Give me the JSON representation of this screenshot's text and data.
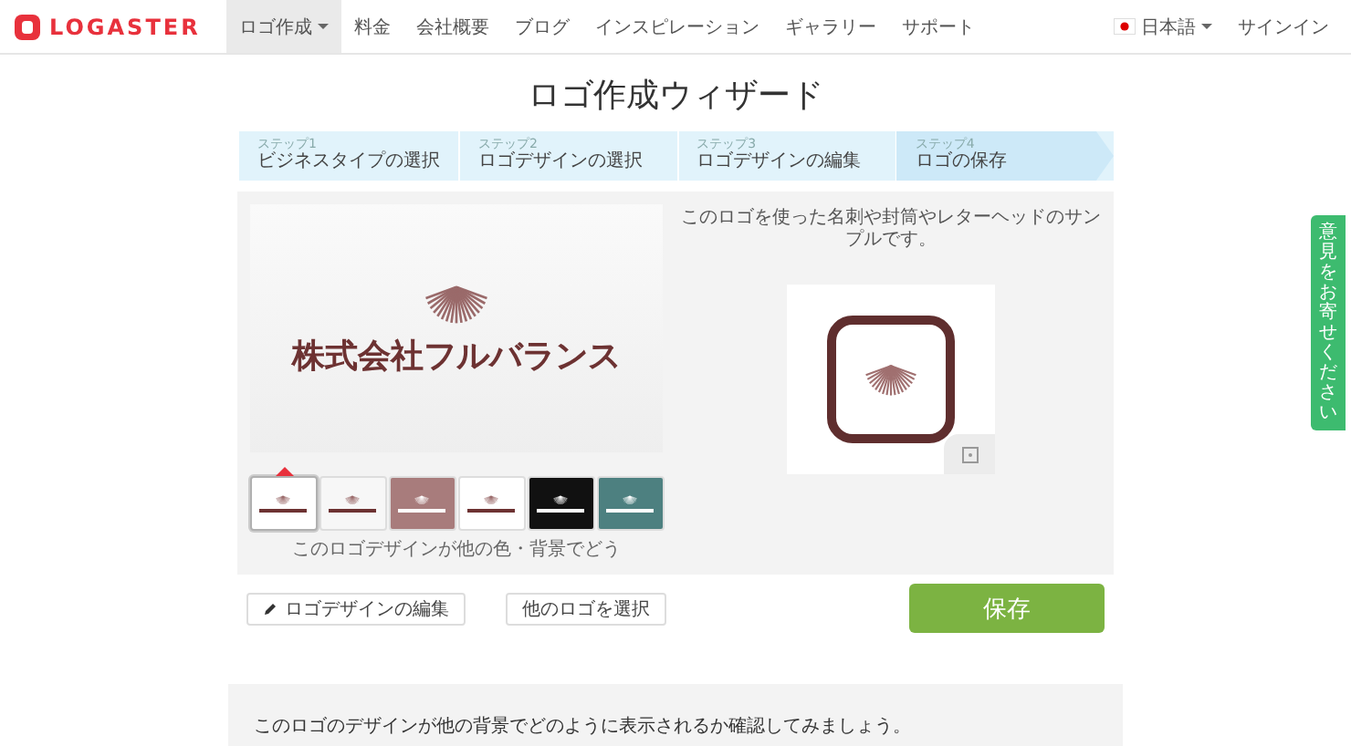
{
  "nav": {
    "brand": "LOGASTER",
    "items": [
      {
        "label": "ロゴ作成",
        "selected": true,
        "dropdown": true
      },
      {
        "label": "料金",
        "selected": false,
        "dropdown": false
      },
      {
        "label": "会社概要",
        "selected": false,
        "dropdown": false
      },
      {
        "label": "ブログ",
        "selected": false,
        "dropdown": false
      },
      {
        "label": "インスピレーション",
        "selected": false,
        "dropdown": false
      },
      {
        "label": "ギャラリー",
        "selected": false,
        "dropdown": false
      },
      {
        "label": "サポート",
        "selected": false,
        "dropdown": false
      }
    ],
    "language": "日本語",
    "signin": "サインイン"
  },
  "title": "ロゴ作成ウィザード",
  "steps": [
    {
      "number": "ステップ1",
      "label": "ビジネスタイプの選択",
      "selected": false
    },
    {
      "number": "ステップ2",
      "label": "ロゴデザインの選択",
      "selected": false
    },
    {
      "number": "ステップ3",
      "label": "ロゴデザインの編集",
      "selected": false
    },
    {
      "number": "ステップ4",
      "label": "ロゴの保存",
      "selected": true
    }
  ],
  "preview": {
    "company": "株式会社フルバランス",
    "variants": [
      {
        "color": "#ffffff",
        "selected": true
      },
      {
        "color": "#f7f7f7",
        "selected": false
      },
      {
        "color": "#a87c7c",
        "selected": false
      },
      {
        "color": "#ffffff",
        "selected": false
      },
      {
        "color": "#111111",
        "selected": false
      },
      {
        "color": "#4d8080",
        "selected": false
      }
    ],
    "variants_caption": "このロゴデザインが他の色・背景でどう"
  },
  "sample": {
    "caption": "このロゴを使った名刺や封筒やレターヘッドのサンプルです。"
  },
  "actions": {
    "edit": "ロゴデザインの編集",
    "choose_other": "他のロゴを選択",
    "save": "保存"
  },
  "backgrounds_note": "このロゴのデザインが他の背景でどのように表示されるか確認してみましょう。",
  "feedback_tab": "意見をお寄せください"
}
